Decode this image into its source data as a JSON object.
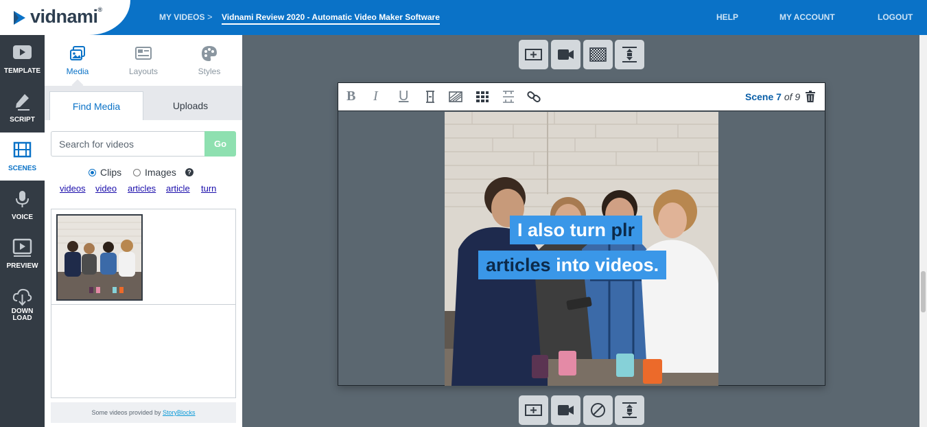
{
  "brand": {
    "name": "vidnami",
    "mark": "®"
  },
  "breadcrumb": {
    "root": "MY VIDEOS",
    "separator": ">",
    "current": "Vidnami Review 2020 - Automatic Video Maker Software"
  },
  "nav": {
    "help": "HELP",
    "account": "MY ACCOUNT",
    "logout": "LOGOUT"
  },
  "sidebar": {
    "items": [
      {
        "label": "TEMPLATE",
        "icon": "play-icon"
      },
      {
        "label": "SCRIPT",
        "icon": "pencil-icon"
      },
      {
        "label": "SCENES",
        "icon": "film-icon",
        "active": true
      },
      {
        "label": "VOICE",
        "icon": "microphone-icon"
      },
      {
        "label": "PREVIEW",
        "icon": "preview-icon"
      },
      {
        "label_line1": "DOWN",
        "label_line2": "LOAD",
        "icon": "download-icon"
      }
    ]
  },
  "media_panel": {
    "tabs": [
      {
        "label": "Media",
        "icon": "media-icon",
        "active": true
      },
      {
        "label": "Layouts",
        "icon": "layouts-icon"
      },
      {
        "label": "Styles",
        "icon": "palette-icon"
      }
    ],
    "subtabs": {
      "find": "Find Media",
      "uploads": "Uploads"
    },
    "search": {
      "placeholder": "Search for videos",
      "value": "",
      "button": "Go"
    },
    "filter": {
      "clips": "Clips",
      "images": "Images",
      "selected": "Clips",
      "help": "?"
    },
    "tags": [
      "videos",
      "video",
      "articles",
      "article",
      "turn"
    ],
    "footer": {
      "text": "Some videos provided by ",
      "link": "StoryBlocks"
    }
  },
  "toolbar_top": [
    "add-scene-icon",
    "video-camera-icon",
    "transparency-icon",
    "fit-icon"
  ],
  "toolbar_bottom": [
    "add-scene-icon",
    "video-camera-icon",
    "no-entry-icon",
    "fit-icon"
  ],
  "editor": {
    "format_tools": [
      "B",
      "I",
      "U"
    ],
    "scene": {
      "prefix": "Scene",
      "current": "7",
      "of_text": "of 9"
    },
    "caption": {
      "line1_part1": "I also turn ",
      "line1_part2": "plr",
      "line2_part1": "articles",
      "line2_part2": " into videos."
    }
  },
  "colors": {
    "topbar": "#0a72c7",
    "rail": "#333b44",
    "workspace": "#5b6770",
    "caption_bg": "#3a97e8",
    "caption_highlight": "#0c2a4a",
    "go_button": "#8ee0b0"
  }
}
